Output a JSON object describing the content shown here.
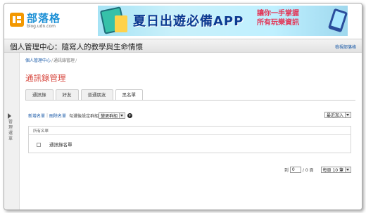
{
  "logo": {
    "name": "部落格",
    "url": "blog.udn.com"
  },
  "ad": {
    "headline": "夏日出遊必備APP",
    "line1": "讓你一手掌握",
    "line2": "所有玩樂資訊"
  },
  "header": {
    "title_prefix": "個人管理中心：",
    "title_blog": "隨寫人的教學與生命情懷",
    "back_link": "檢視部落格"
  },
  "sidebar": {
    "label": "管理選單"
  },
  "breadcrumb": {
    "items": [
      "個人管理中心",
      "通訊錄管理"
    ]
  },
  "page_title": "通訊錄管理",
  "tabs": [
    {
      "label": "通訊錄",
      "active": false
    },
    {
      "label": "好友",
      "active": false
    },
    {
      "label": "普通朋友",
      "active": false
    },
    {
      "label": "黑名單",
      "active": true
    }
  ],
  "actions": {
    "new_list": "新增名單",
    "delete_list": "刪除名單",
    "hint": "勾選後設定群組",
    "group_select": "變更群組"
  },
  "sort": {
    "selected": "最近加入"
  },
  "group_box": {
    "legend": "所有名單",
    "row_label": "通訊錄名單"
  },
  "pager": {
    "prefix": "到",
    "page_value": "0",
    "total": "/ 0 頁",
    "per_page": "每頁 10 筆"
  },
  "colors": {
    "accent": "#d6433a",
    "link": "#1a5aa8",
    "logo": "#f39800"
  }
}
